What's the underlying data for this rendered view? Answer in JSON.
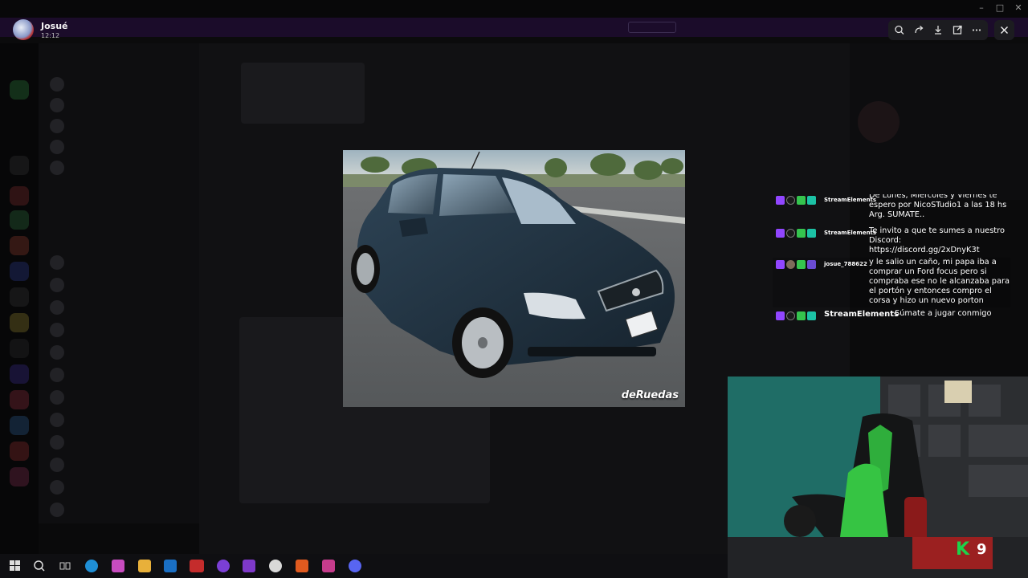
{
  "viewer": {
    "user_name": "Josué",
    "time": "12:12"
  },
  "toolbar": {
    "zoom_icon": "zoom-in-icon",
    "forward_icon": "forward-icon",
    "download_icon": "download-icon",
    "open_icon": "open-external-icon",
    "more_icon": "more-icon",
    "close_icon": "close-icon"
  },
  "photo": {
    "watermark": "deRuedas"
  },
  "stream_chat": [
    {
      "user": "StreamElements",
      "text": "De Lunes, Miércoles y Viernes te espero por NicoSTudio1 a las 18 hs Arg. SUMATE.."
    },
    {
      "user": "StreamElements",
      "text": "Te invito a que te sumes a nuestro Discord: https://discord.gg/2xDnyK3t"
    },
    {
      "user": "josue_788622",
      "text": "y le salio un caño, mi papa iba a comprar un Ford focus pero si compraba ese no le alcanzaba para el portón y entonces compro el corsa y hizo un nuevo porton"
    },
    {
      "user": "StreamElements",
      "text": "Súmate a jugar conmigo"
    }
  ],
  "webcam": {
    "sub_count": "9"
  },
  "colors": {
    "twitch_purple": "#9146ff",
    "badge_green": "#35c44e",
    "kick_green": "#1dd24a",
    "overlay_bg": "#0b0b0c"
  }
}
